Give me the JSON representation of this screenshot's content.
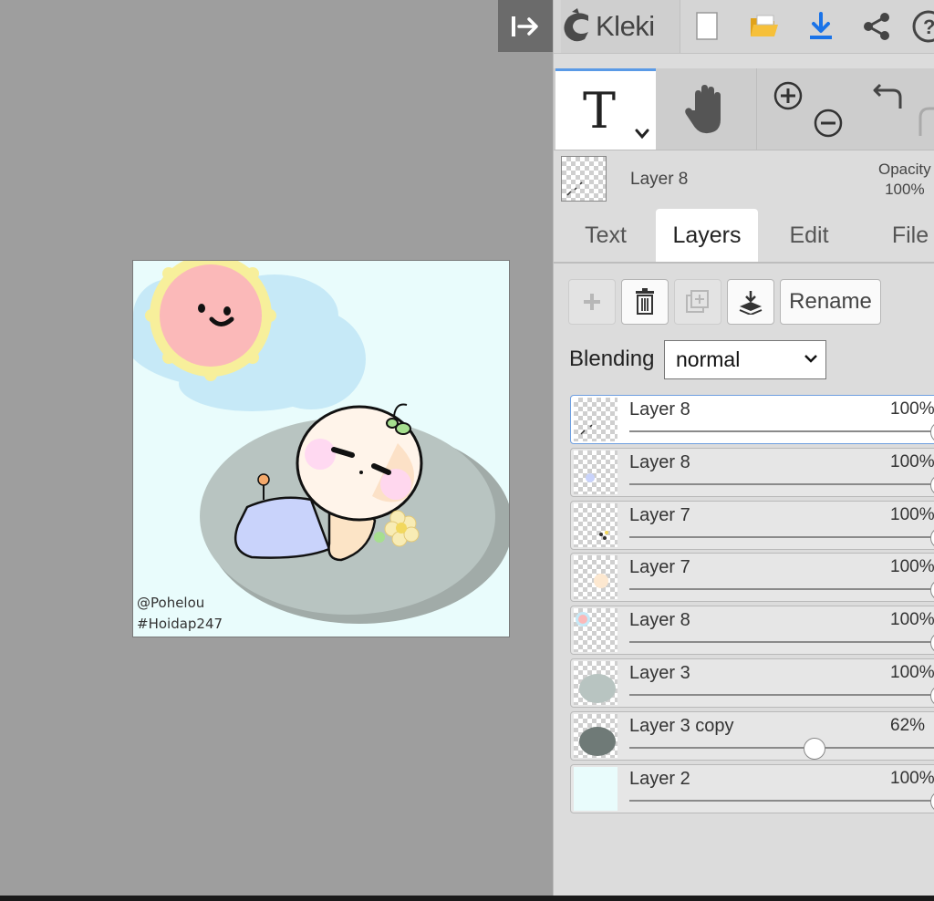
{
  "workspace": {
    "collapse_icon": "collapse-panel-icon",
    "canvas": {
      "watermark_line1": "@Pohelou",
      "watermark_line2": "#Hoidap247",
      "colors": {
        "background": "#e9fcfc",
        "cloud": "#c6e9f7",
        "sun": "#fbb9b9",
        "sun_ray": "#f7ef9b",
        "ground": "#b8c4c1"
      }
    }
  },
  "topbar": {
    "app_name": "Kleki",
    "icons": [
      "new-file-icon",
      "open-folder-icon",
      "download-icon",
      "share-icon",
      "help-icon"
    ],
    "accent": "#1a73e8"
  },
  "tools": {
    "active": "text-tool",
    "items": [
      "text-tool-icon",
      "hand-tool-icon",
      "zoom-in-icon",
      "zoom-out-icon",
      "undo-icon",
      "redo-icon"
    ]
  },
  "layer_info": {
    "name": "Layer 8",
    "opacity_label": "Opacity",
    "opacity_value": "100%"
  },
  "tabs": [
    {
      "label": "Text"
    },
    {
      "label": "Layers",
      "active": true
    },
    {
      "label": "Edit"
    },
    {
      "label": "File"
    }
  ],
  "layer_actions": {
    "buttons": [
      "add-layer-icon",
      "delete-layer-icon",
      "duplicate-layer-icon",
      "merge-down-icon"
    ],
    "rename_label": "Rename"
  },
  "blending": {
    "label": "Blending",
    "value": "normal"
  },
  "layers": [
    {
      "name": "Layer 8",
      "opacity": "100%",
      "opacity_value": 1.0,
      "selected": true
    },
    {
      "name": "Layer 8",
      "opacity": "100%",
      "opacity_value": 1.0
    },
    {
      "name": "Layer 7",
      "opacity": "100%",
      "opacity_value": 1.0
    },
    {
      "name": "Layer 7",
      "opacity": "100%",
      "opacity_value": 1.0
    },
    {
      "name": "Layer 8",
      "opacity": "100%",
      "opacity_value": 1.0
    },
    {
      "name": "Layer 3",
      "opacity": "100%",
      "opacity_value": 1.0
    },
    {
      "name": "Layer 3 copy",
      "opacity": "62%",
      "opacity_value": 0.62
    },
    {
      "name": "Layer 2",
      "opacity": "100%",
      "opacity_value": 1.0
    }
  ]
}
